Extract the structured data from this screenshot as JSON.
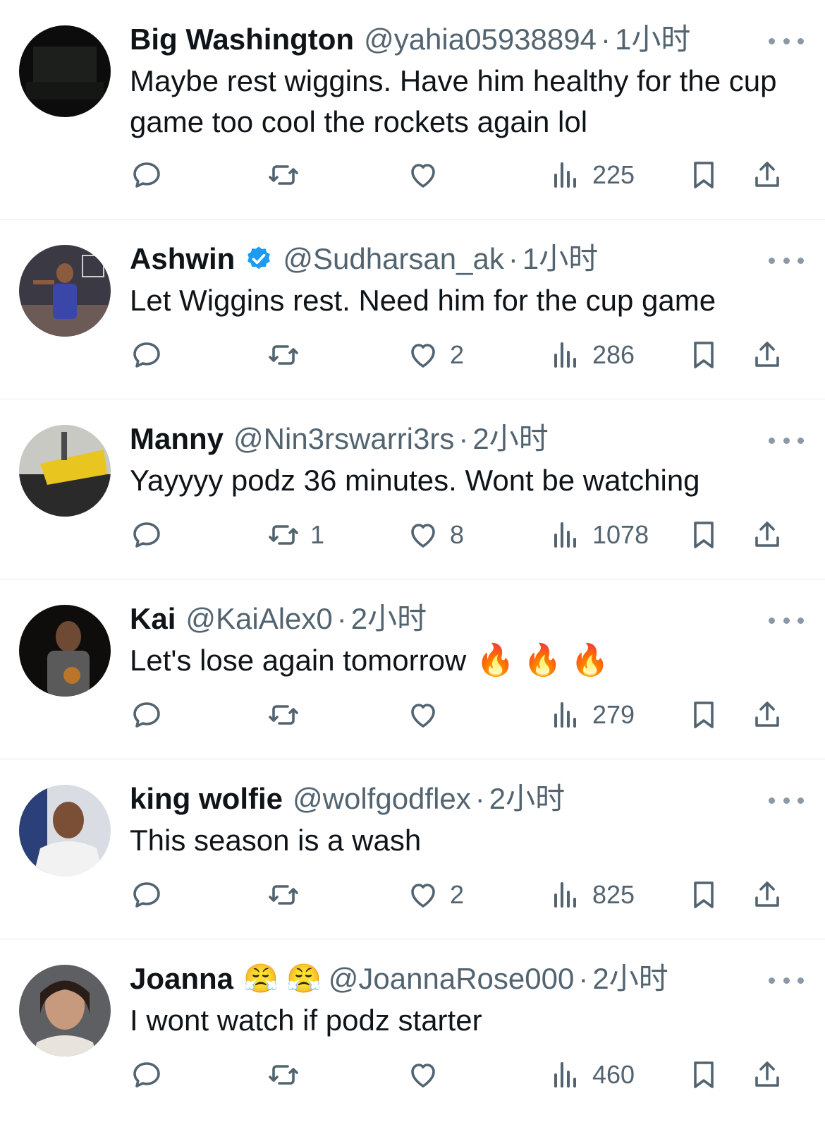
{
  "tweets": [
    {
      "name": "Big Washington",
      "handle": "@yahia05938894",
      "dot": "·",
      "time": "1小时",
      "text": "Maybe rest wiggins. Have him healthy for the cup game too cool the rockets again lol",
      "replies": "",
      "retweets": "",
      "likes": "",
      "views": "225"
    },
    {
      "name": "Ashwin",
      "handle": "@Sudharsan_ak",
      "dot": "·",
      "time": "1小时",
      "text": "Let Wiggins rest. Need him for the cup game",
      "replies": "",
      "retweets": "",
      "likes": "2",
      "views": "286"
    },
    {
      "name": "Manny",
      "handle": "@Nin3rswarri3rs",
      "dot": "·",
      "time": "2小时",
      "text": "Yayyyy podz 36 minutes. Wont be watching",
      "replies": "",
      "retweets": "1",
      "likes": "8",
      "views": "1078"
    },
    {
      "name": "Kai",
      "handle": "@KaiAlex0",
      "dot": "·",
      "time": "2小时",
      "text": "Let's lose again tomorrow",
      "fire": "🔥 🔥 🔥",
      "replies": "",
      "retweets": "",
      "likes": "",
      "views": "279"
    },
    {
      "name": "king wolfie",
      "handle": "@wolfgodflex",
      "dot": "·",
      "time": "2小时",
      "text": "This season is a wash",
      "replies": "",
      "retweets": "",
      "likes": "2",
      "views": "825"
    },
    {
      "name": "Joanna",
      "name_emoji": "😤 😤",
      "handle": "@JoannaRose000",
      "dot": "·",
      "time": "2小时",
      "text": "I wont watch if podz starter",
      "replies": "",
      "retweets": "",
      "likes": "",
      "views": "460"
    }
  ],
  "icons": {
    "reply": "reply-icon",
    "retweet": "retweet-icon",
    "like": "heart-icon",
    "views": "views-icon",
    "bookmark": "bookmark-icon",
    "share": "share-icon",
    "more": "more-icon",
    "verified": "verified-badge-icon"
  },
  "colors": {
    "text": "#0f1419",
    "secondary": "#536471",
    "verified": "#1d9bf0",
    "divider": "#e6e9ec"
  }
}
